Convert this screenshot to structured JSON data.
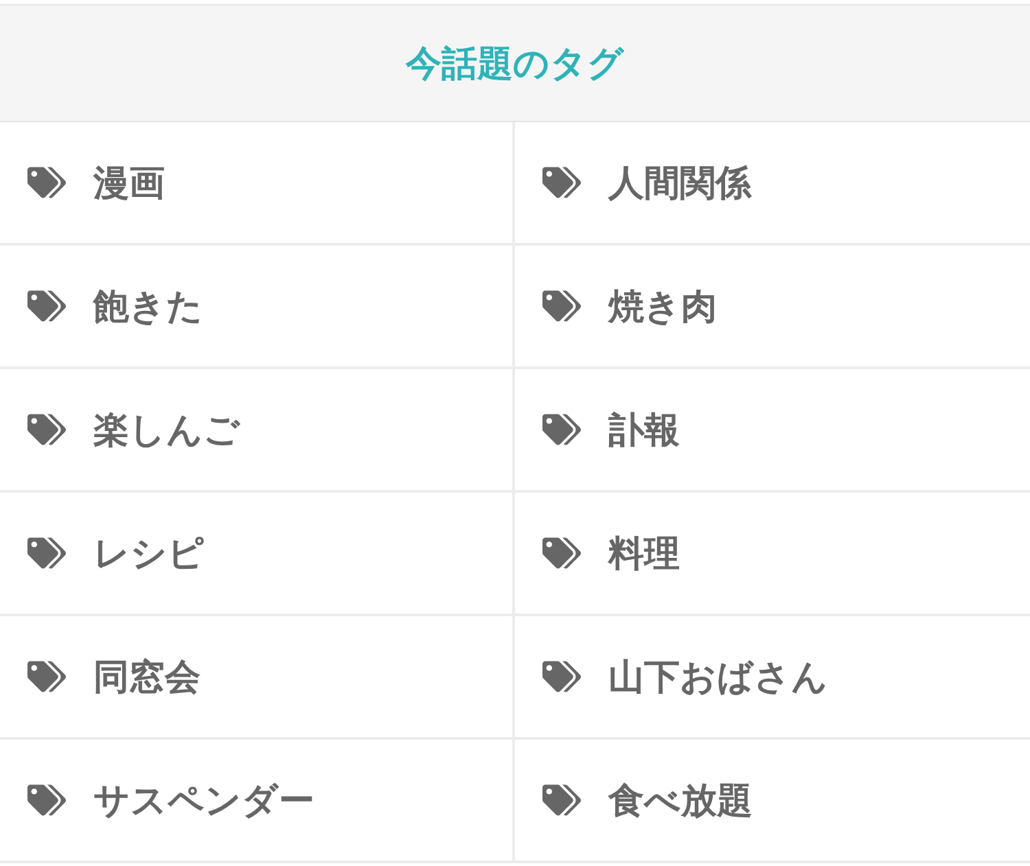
{
  "title": "今話題のタグ",
  "tags": [
    "漫画",
    "人間関係",
    "飽きた",
    "焼き肉",
    "楽しんご",
    "訃報",
    "レシピ",
    "料理",
    "同窓会",
    "山下おばさん",
    "サスペンダー",
    "食べ放題"
  ]
}
